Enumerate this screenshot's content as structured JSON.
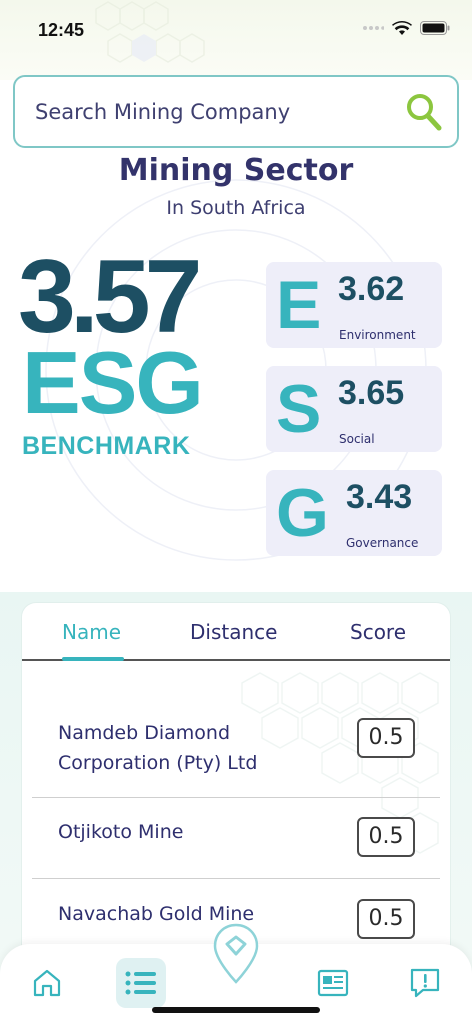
{
  "status": {
    "time": "12:45"
  },
  "search": {
    "placeholder": "Search Mining Company"
  },
  "sector": {
    "title": "Mining Sector",
    "subtitle": "In South Africa"
  },
  "benchmark": {
    "score": "3.57",
    "label": "ESG",
    "caption": "BENCHMARK"
  },
  "pillars": [
    {
      "letter": "E",
      "value": "3.62",
      "label": "Environment"
    },
    {
      "letter": "S",
      "value": "3.65",
      "label": "Social"
    },
    {
      "letter": "G",
      "value": "3.43",
      "label": "Governance"
    }
  ],
  "tabs": [
    {
      "label": "Name",
      "active": true
    },
    {
      "label": "Distance",
      "active": false
    },
    {
      "label": "Score",
      "active": false
    }
  ],
  "companies": [
    {
      "name": "Namdeb Diamond Corporation (Pty) Ltd",
      "score": "0.5"
    },
    {
      "name": "Otjikoto Mine",
      "score": "0.5"
    },
    {
      "name": "Navachab Gold Mine",
      "score": "0.5"
    }
  ],
  "colors": {
    "accent": "#37b4bd",
    "dark_teal": "#1d4f63",
    "navy": "#2e2f6e",
    "pillar_bg": "#eeeef9"
  },
  "nav": {
    "items": [
      {
        "icon": "home-icon",
        "active": false
      },
      {
        "icon": "list-icon",
        "active": true
      },
      {
        "icon": "map-pin-icon",
        "active": false
      },
      {
        "icon": "news-icon",
        "active": false
      },
      {
        "icon": "feedback-icon",
        "active": false
      }
    ]
  }
}
